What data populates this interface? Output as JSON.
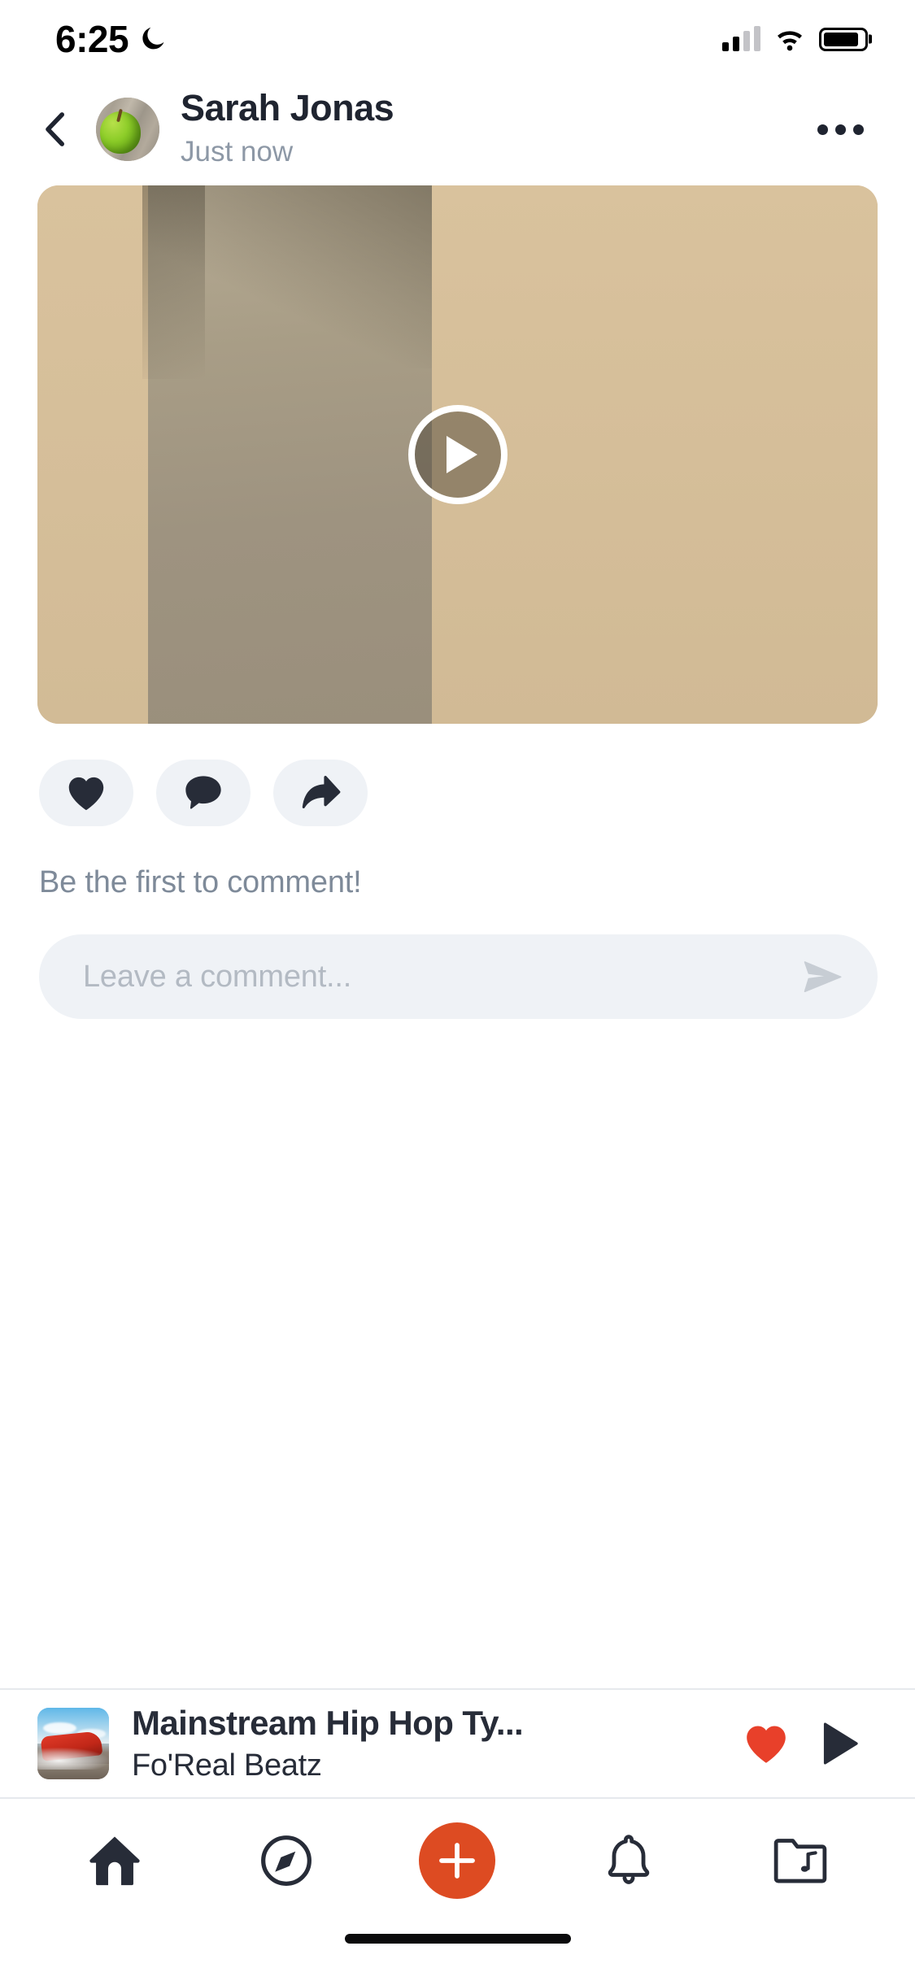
{
  "status_bar": {
    "time": "6:25",
    "dnd_icon": "crescent-moon-icon",
    "signal_icon": "cellular-signal-icon",
    "wifi_icon": "wifi-icon",
    "battery_icon": "battery-icon"
  },
  "header": {
    "back_icon": "chevron-left-icon",
    "avatar_icon": "user-avatar-green-apple",
    "author_name": "Sarah Jonas",
    "timestamp": "Just now",
    "more_icon": "ellipsis-horizontal-icon"
  },
  "post": {
    "media_type": "video",
    "play_icon": "play-circle-icon",
    "actions": [
      {
        "name": "like",
        "icon": "heart-filled-icon"
      },
      {
        "name": "comment",
        "icon": "speech-bubble-icon"
      },
      {
        "name": "share",
        "icon": "share-arrow-icon"
      }
    ],
    "comments_empty_text": "Be the first to comment!",
    "comment_input_value": "",
    "comment_input_placeholder": "Leave a comment...",
    "send_icon": "send-paper-plane-icon"
  },
  "music_bar": {
    "album_art_icon": "album-art-red-muscle-car",
    "track_title": "Mainstream Hip Hop Ty...",
    "track_artist": "Fo'Real Beatz",
    "like_icon": "heart-filled-icon",
    "play_icon": "play-triangle-icon"
  },
  "bottom_nav": {
    "items": [
      {
        "name": "home",
        "icon": "home-icon"
      },
      {
        "name": "discover",
        "icon": "compass-icon"
      },
      {
        "name": "create",
        "icon": "plus-icon"
      },
      {
        "name": "notifications",
        "icon": "bell-icon"
      },
      {
        "name": "library",
        "icon": "music-folder-icon"
      }
    ]
  },
  "colors": {
    "accent": "#dd4b22",
    "like_red": "#e8402a",
    "dark": "#272c38",
    "muted": "#7e8a99",
    "field_bg": "#eff2f6"
  }
}
